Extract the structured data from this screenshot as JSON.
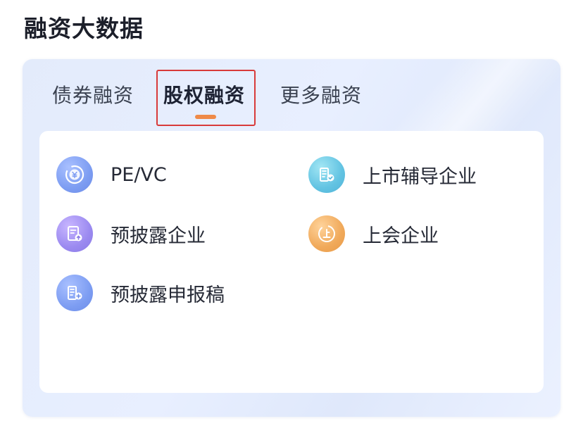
{
  "header": {
    "title": "融资大数据"
  },
  "tabs": [
    {
      "label": "债券融资",
      "selected": false
    },
    {
      "label": "股权融资",
      "selected": true
    },
    {
      "label": "更多融资",
      "selected": false
    }
  ],
  "items": [
    {
      "label": "PE/VC",
      "icon": "coin-icon"
    },
    {
      "label": "上市辅导企业",
      "icon": "building-check-icon"
    },
    {
      "label": "预披露企业",
      "icon": "document-upload-icon"
    },
    {
      "label": "上会企业",
      "icon": "listing-badge-icon"
    },
    {
      "label": "预披露申报稿",
      "icon": "building-plus-icon"
    }
  ],
  "colors": {
    "tab_indicator": "#ef8a48",
    "highlight_box": "#d83a3a"
  }
}
